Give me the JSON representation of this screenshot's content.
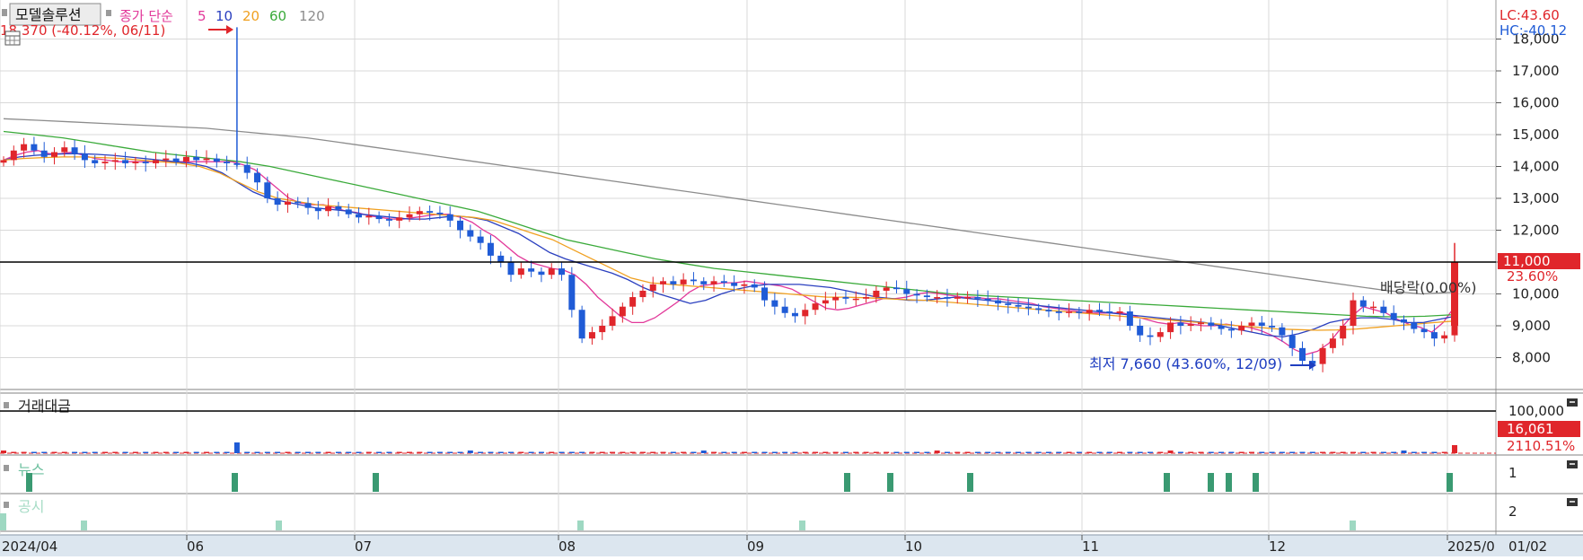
{
  "header": {
    "company": "모델솔루션",
    "ma_title": "종가 단순",
    "ma_periods": [
      "5",
      "10",
      "20",
      "60",
      "120"
    ],
    "high_marker": "18,370 (-40.12%, 06/11)",
    "low_marker": "최저 7,660 (43.60%, 12/09)",
    "lc": "LC:43.60",
    "hc": "HC:-40.12"
  },
  "price_axis": {
    "ticks": [
      "8,000",
      "9,000",
      "10,000",
      "11,000",
      "12,000",
      "13,000",
      "14,000",
      "15,000",
      "16,000",
      "17,000",
      "18,000"
    ],
    "current_price": "11,000",
    "current_change": "23.60%"
  },
  "annotation": {
    "dividend": "배당락(0.00%)"
  },
  "volume_panel": {
    "title": "거래대금",
    "axis_label": "100,000",
    "current": "16,061",
    "change": "2110.51%"
  },
  "news_panel": {
    "title": "뉴스",
    "axis_label": "1"
  },
  "disclosure_panel": {
    "title": "공시",
    "axis_label": "2"
  },
  "x_axis": {
    "labels": [
      "2024/04",
      "06",
      "07",
      "08",
      "09",
      "10",
      "11",
      "12",
      "2025/0",
      "01/02"
    ]
  },
  "colors": {
    "up": "#e0262b",
    "down": "#1f5bd6",
    "ma5": "#e2399a",
    "ma10": "#2a3fbf",
    "ma20": "#f0a020",
    "ma60": "#3aaa3a",
    "ma120": "#8c8c8c",
    "news": "#3a9a72",
    "disclosure": "#9ed8c2"
  },
  "chart_data": {
    "type": "candlestick",
    "title": "모델솔루션",
    "period": "2024/04 - 2025/01",
    "yrange": [
      7300,
      18500
    ],
    "reference_line": 11000,
    "high": {
      "price": 18370,
      "date": "06/11"
    },
    "low": {
      "price": 7660,
      "date": "12/09"
    },
    "close_series": [
      14200,
      14500,
      14700,
      14500,
      14300,
      14450,
      14600,
      14400,
      14200,
      14100,
      14150,
      14200,
      14100,
      14150,
      14100,
      14200,
      14250,
      14150,
      14300,
      14200,
      14250,
      14150,
      14100,
      14050,
      13800,
      13500,
      13000,
      12800,
      12900,
      12850,
      12700,
      12600,
      12750,
      12650,
      12500,
      12400,
      12450,
      12350,
      12300,
      12400,
      12500,
      12600,
      12550,
      12500,
      12300,
      12000,
      11800,
      11600,
      11200,
      11000,
      10600,
      10800,
      10700,
      10600,
      10800,
      10600,
      9500,
      8600,
      8800,
      9000,
      9300,
      9600,
      9900,
      10100,
      10300,
      10400,
      10300,
      10450,
      10400,
      10300,
      10400,
      10350,
      10250,
      10300,
      10200,
      9800,
      9600,
      9400,
      9300,
      9500,
      9700,
      9800,
      9900,
      9850,
      9850,
      9900,
      10100,
      10200,
      10150,
      10000,
      9950,
      9900,
      9900,
      9850,
      9900,
      9900,
      9850,
      9800,
      9700,
      9650,
      9600,
      9550,
      9500,
      9450,
      9400,
      9450,
      9400,
      9500,
      9450,
      9400,
      9450,
      9000,
      8700,
      8650,
      8800,
      9100,
      9000,
      9050,
      9100,
      9000,
      8900,
      8850,
      9000,
      9100,
      9000,
      8950,
      8700,
      8300,
      7900,
      7800,
      8300,
      8600,
      9000,
      9800,
      9600,
      9600,
      9400,
      9200,
      9100,
      8900,
      8800,
      8600,
      8700,
      11000
    ],
    "ma_series": {
      "5": [
        14200,
        14350,
        14450,
        14500,
        14400,
        14400,
        14450,
        14350,
        14250,
        14200,
        14150,
        14150,
        14150,
        14150,
        14150,
        14150,
        14150,
        14150,
        14150,
        14150,
        14150,
        14050,
        13900,
        13600,
        13300,
        13000,
        12850,
        12800,
        12800,
        12700,
        12600,
        12550,
        12450,
        12400,
        12350,
        12350,
        12400,
        12450,
        12500,
        12500,
        12400,
        12250,
        12000,
        11800,
        11500,
        11200,
        11000,
        10900,
        10800,
        10750,
        10600,
        10300,
        9900,
        9600,
        9300,
        9100,
        9100,
        9250,
        9500,
        9750,
        10050,
        10250,
        10300,
        10350,
        10350,
        10400,
        10350,
        10300,
        10250,
        10150,
        9950,
        9750,
        9550,
        9500,
        9550,
        9650,
        9750,
        9850,
        9850,
        9900,
        10000,
        10050,
        10000,
        9950,
        9900,
        9900,
        9850,
        9850,
        9800,
        9750,
        9700,
        9600,
        9550,
        9500,
        9450,
        9400,
        9400,
        9400,
        9400,
        9300,
        9200,
        9100,
        9050,
        9100,
        9050,
        9000,
        9000,
        9050,
        9000,
        8950,
        8850,
        8700,
        8500,
        8250,
        8100,
        8200,
        8450,
        8900,
        9300,
        9600,
        9500,
        9400,
        9200,
        9050,
        8950,
        8800,
        9100,
        9600
      ],
      "10": [
        14200,
        14300,
        14350,
        14380,
        14400,
        14400,
        14380,
        14350,
        14300,
        14250,
        14200,
        14150,
        14100,
        14000,
        13800,
        13500,
        13200,
        13000,
        12900,
        12800,
        12700,
        12650,
        12600,
        12500,
        12450,
        12400,
        12350,
        12350,
        12400,
        12450,
        12400,
        12300,
        12100,
        11900,
        11600,
        11300,
        11100,
        10950,
        10800,
        10650,
        10450,
        10200,
        10000,
        9850,
        9700,
        9800,
        10000,
        10150,
        10250,
        10300,
        10300,
        10300,
        10250,
        10200,
        10100,
        10000,
        9900,
        9850,
        9800,
        9800,
        9850,
        9900,
        9850,
        9800,
        9750,
        9700,
        9650,
        9600,
        9550,
        9500,
        9450,
        9400,
        9350,
        9300,
        9250,
        9200,
        9150,
        9100,
        9000,
        8900,
        8800,
        8700,
        8650,
        8750,
        8900,
        9100,
        9200,
        9250,
        9250,
        9200,
        9100,
        9100,
        9200,
        9300
      ],
      "20": [
        14200,
        14250,
        14280,
        14300,
        14300,
        14280,
        14250,
        14200,
        14150,
        14100,
        14000,
        13800,
        13500,
        13200,
        13000,
        12900,
        12800,
        12750,
        12700,
        12650,
        12600,
        12550,
        12500,
        12450,
        12400,
        12300,
        12100,
        11900,
        11700,
        11400,
        11100,
        10800,
        10500,
        10350,
        10300,
        10250,
        10200,
        10150,
        10100,
        10050,
        10000,
        9950,
        9900,
        9900,
        9880,
        9850,
        9820,
        9800,
        9750,
        9700,
        9650,
        9600,
        9550,
        9500,
        9450,
        9400,
        9350,
        9300,
        9250,
        9200,
        9150,
        9100,
        9050,
        9000,
        8950,
        8900,
        8880,
        8860,
        8870,
        8900,
        8950,
        9000,
        9050,
        9100,
        9150
      ],
      "60": [
        15100,
        15000,
        14900,
        14750,
        14600,
        14450,
        14350,
        14250,
        14150,
        14000,
        13800,
        13600,
        13400,
        13200,
        13000,
        12800,
        12600,
        12300,
        12000,
        11700,
        11500,
        11300,
        11100,
        10950,
        10800,
        10700,
        10600,
        10500,
        10400,
        10300,
        10200,
        10100,
        10000,
        9950,
        9900,
        9850,
        9800,
        9750,
        9700,
        9650,
        9600,
        9550,
        9500,
        9450,
        9400,
        9350,
        9300,
        9280,
        9300,
        9350
      ],
      "120": [
        15500,
        15450,
        15400,
        15350,
        15300,
        15250,
        15200,
        15100,
        15000,
        14900,
        14750,
        14600,
        14450,
        14300,
        14150,
        14000,
        13850,
        13700,
        13550,
        13400,
        13250,
        13100,
        12950,
        12800,
        12650,
        12500,
        12350,
        12200,
        12050,
        11900,
        11750,
        11600,
        11450,
        11300,
        11150,
        11000,
        10850,
        10700,
        10550,
        10400,
        10250,
        10100,
        10000,
        10050
      ]
    },
    "volume_trading_value": {
      "current": 16061,
      "change_pct": 2110.51
    },
    "news_markers": 14,
    "disclosure_markers": 7
  }
}
